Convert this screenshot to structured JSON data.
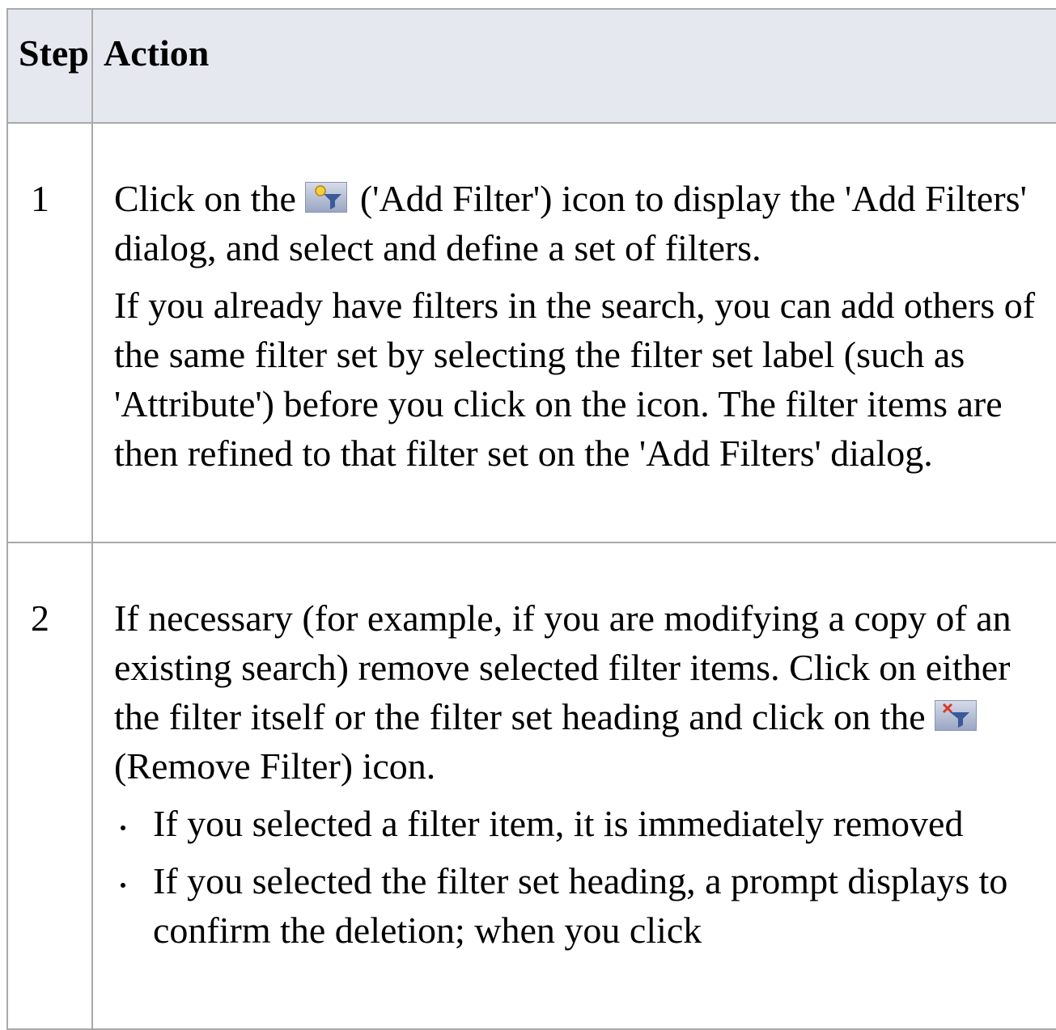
{
  "header": {
    "step_label": "Step",
    "action_label": "Action"
  },
  "rows": [
    {
      "step": "1",
      "p1_before": "Click on the",
      "p1_icon": "add-filter-icon",
      "p1_after": " ('Add Filter') icon to display the 'Add Filters' dialog, and select and define a set of filters.",
      "p2": "If you already have filters in the search, you can add others of the same filter set by selecting the filter set label (such as 'Attribute') before you click on the icon. The filter items are then refined to that filter set on the 'Add Filters' dialog."
    },
    {
      "step": "2",
      "p1_before": "If necessary (for example, if you are modifying a copy of an existing search) remove selected filter items. Click on either the filter itself or the filter set heading and click on the",
      "p1_icon": "remove-filter-icon",
      "p1_after": " (Remove Filter) icon.",
      "bullets": [
        "If you selected a filter item, it is immediately removed",
        "If you selected the filter set heading, a prompt displays to confirm the deletion; when you click"
      ]
    }
  ]
}
